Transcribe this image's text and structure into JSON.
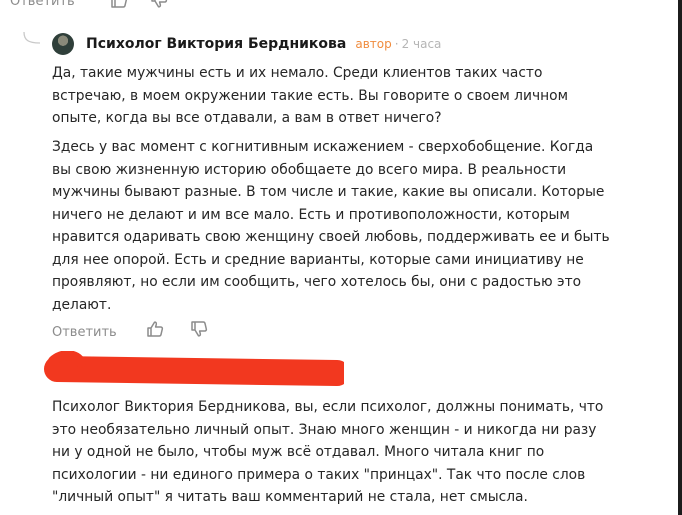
{
  "prev_comment": {
    "reply_label": "Ответить"
  },
  "reply": {
    "author": "Психолог Виктория Бердникова",
    "badge": "автор",
    "separator": "·",
    "time": "2 часа",
    "paragraphs": [
      "Да, такие мужчины есть и их немало. Среди клиентов таких часто встречаю, в моем окружении такие есть. Вы говорите о своем личном опыте, когда вы все отдавали, а вам в ответ ничего?",
      "Здесь у вас момент с когнитивным искажением - сверхобобщение. Когда вы свою жизненную историю обобщаете до всего мира. В реальности мужчины бывают разные. В том числе и такие, какие вы описали. Которые ничего не делают и им все мало. Есть и противоположности, которым нравится одаривать свою женщину своей любовь, поддерживать ее и быть для нее опорой. Есть и средние варианты, которые сами инициативу не проявляют, но если им сообщить, чего хотелось бы, они с радостью это делают."
    ],
    "reply_label": "Ответить"
  },
  "next_comment": {
    "text": "Психолог Виктория Бердникова, вы, если психолог, должны понимать, что это необязательно личный опыт. Знаю много женщин - и никогда ни разу ни у одной не было, чтобы муж всё отдавал. Много читала книг по психологии - ни единого примера о таких \"принцах\". Так что после слов \"личный опыт\" я читать ваш комментарий не стала, нет смысла."
  },
  "icons": {
    "like": "thumbs-up-icon",
    "dislike": "thumbs-down-icon",
    "thread": "thread-curve-icon"
  },
  "colors": {
    "badge": "#f08c3e",
    "redaction": "#f2381f",
    "muted": "#8c8c8c"
  }
}
